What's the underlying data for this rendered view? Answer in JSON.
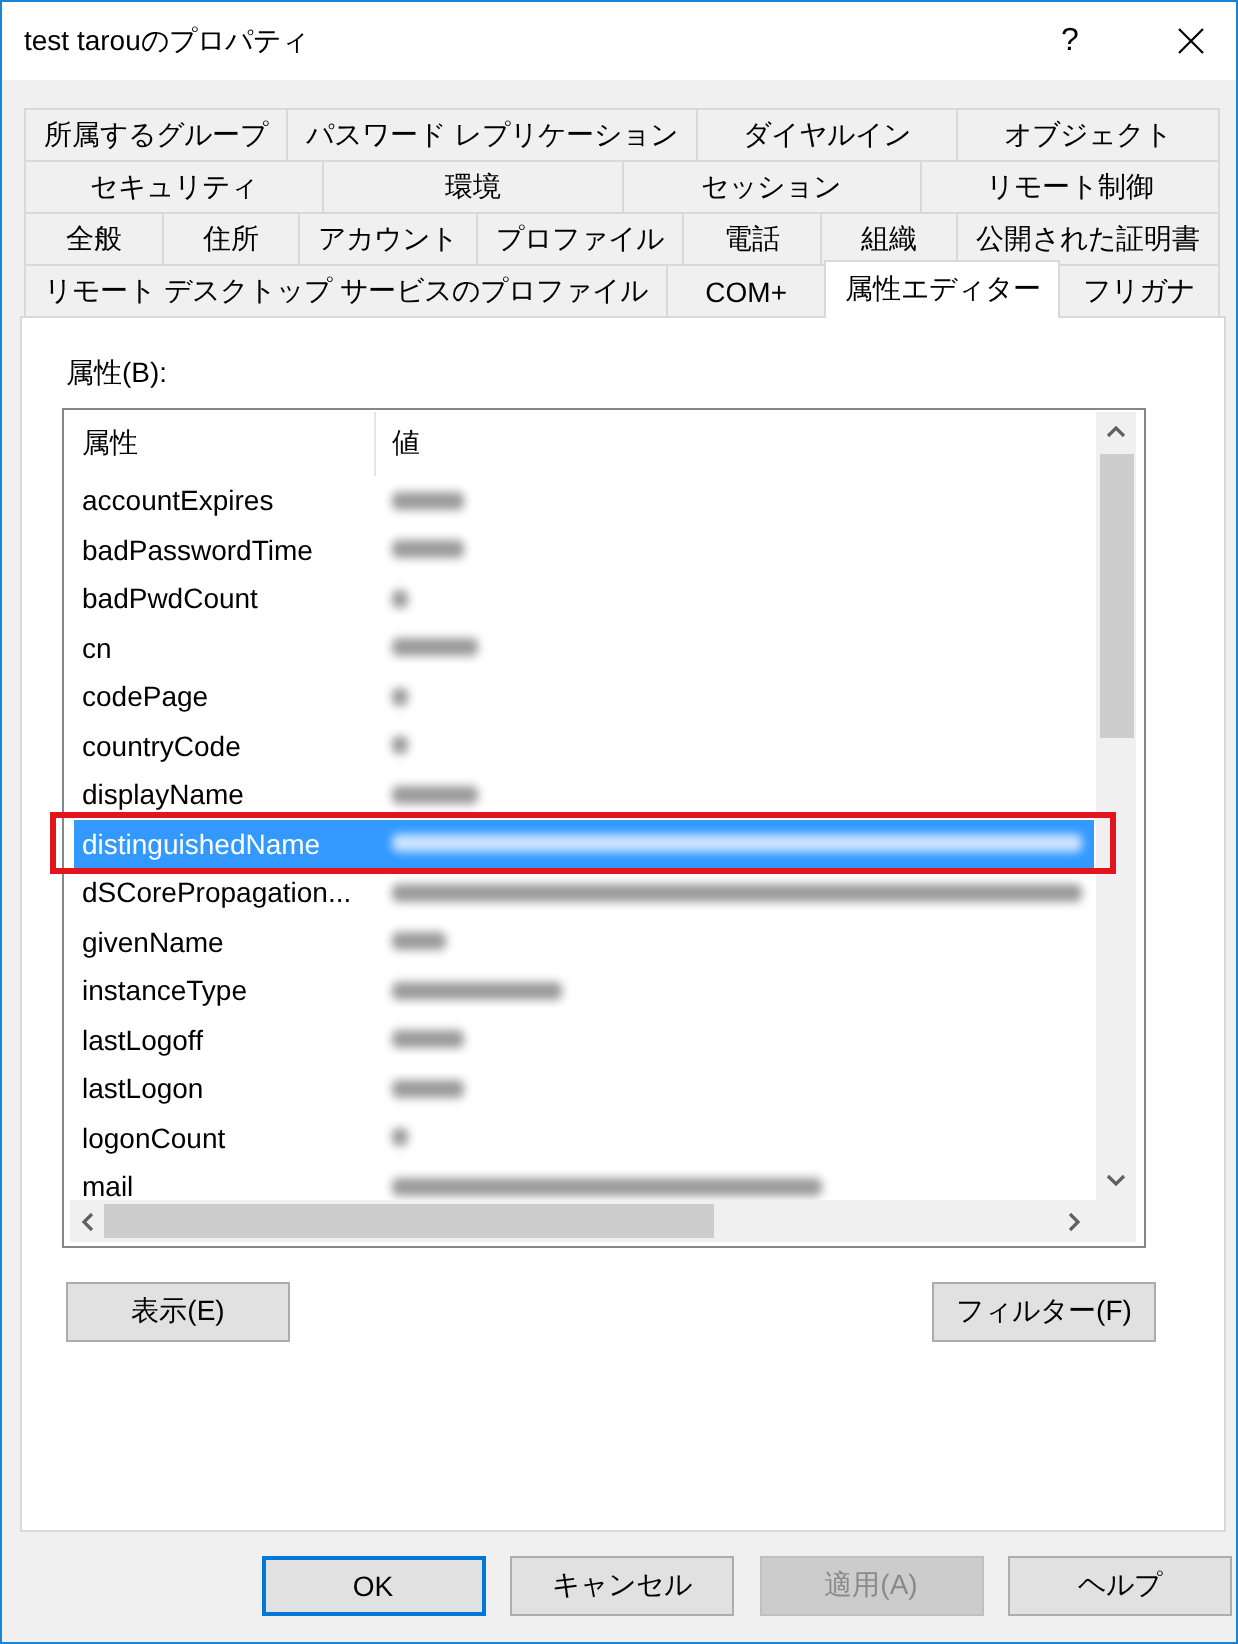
{
  "window": {
    "title": "test tarouのプロパティ",
    "help_button": "?"
  },
  "tab_rows": [
    {
      "tabs": [
        {
          "label": "所属するグループ",
          "selected": false
        },
        {
          "label": "パスワード レプリケーション",
          "selected": false
        },
        {
          "label": "ダイヤルイン",
          "selected": false
        },
        {
          "label": "オブジェクト",
          "selected": false
        }
      ]
    },
    {
      "tabs": [
        {
          "label": "セキュリティ",
          "selected": false
        },
        {
          "label": "環境",
          "selected": false
        },
        {
          "label": "セッション",
          "selected": false
        },
        {
          "label": "リモート制御",
          "selected": false
        }
      ]
    },
    {
      "tabs": [
        {
          "label": "全般",
          "selected": false
        },
        {
          "label": "住所",
          "selected": false
        },
        {
          "label": "アカウント",
          "selected": false
        },
        {
          "label": "プロファイル",
          "selected": false
        },
        {
          "label": "電話",
          "selected": false
        },
        {
          "label": "組織",
          "selected": false
        },
        {
          "label": "公開された証明書",
          "selected": false
        }
      ]
    },
    {
      "tabs": [
        {
          "label": "リモート デスクトップ サービスのプロファイル",
          "selected": false
        },
        {
          "label": "COM+",
          "selected": false
        },
        {
          "label": "属性エディター",
          "selected": true
        },
        {
          "label": "フリガナ",
          "selected": false
        }
      ]
    }
  ],
  "attributes": {
    "label": "属性(B):",
    "columns": [
      "属性",
      "値"
    ],
    "rows": [
      {
        "name": "accountExpires",
        "selected": false,
        "highlighted": false
      },
      {
        "name": "badPasswordTime",
        "selected": false,
        "highlighted": false
      },
      {
        "name": "badPwdCount",
        "selected": false,
        "highlighted": false
      },
      {
        "name": "cn",
        "selected": false,
        "highlighted": false
      },
      {
        "name": "codePage",
        "selected": false,
        "highlighted": false
      },
      {
        "name": "countryCode",
        "selected": false,
        "highlighted": false
      },
      {
        "name": "displayName",
        "selected": false,
        "highlighted": false
      },
      {
        "name": "distinguishedName",
        "selected": true,
        "highlighted": true
      },
      {
        "name": "dSCorePropagation...",
        "selected": false,
        "highlighted": false
      },
      {
        "name": "givenName",
        "selected": false,
        "highlighted": false
      },
      {
        "name": "instanceType",
        "selected": false,
        "highlighted": false
      },
      {
        "name": "lastLogoff",
        "selected": false,
        "highlighted": false
      },
      {
        "name": "lastLogon",
        "selected": false,
        "highlighted": false
      },
      {
        "name": "logonCount",
        "selected": false,
        "highlighted": false
      },
      {
        "name": "mail",
        "selected": false,
        "highlighted": false
      }
    ]
  },
  "panel_buttons": [
    {
      "label": "表示(E)"
    },
    {
      "label": "フィルター(F)"
    }
  ],
  "dialog_buttons": [
    {
      "label": "OK",
      "focused": true,
      "disabled": false
    },
    {
      "label": "キャンセル",
      "focused": false,
      "disabled": false
    },
    {
      "label": "適用(A)",
      "focused": false,
      "disabled": true
    },
    {
      "label": "ヘルプ",
      "focused": false,
      "disabled": false
    }
  ]
}
